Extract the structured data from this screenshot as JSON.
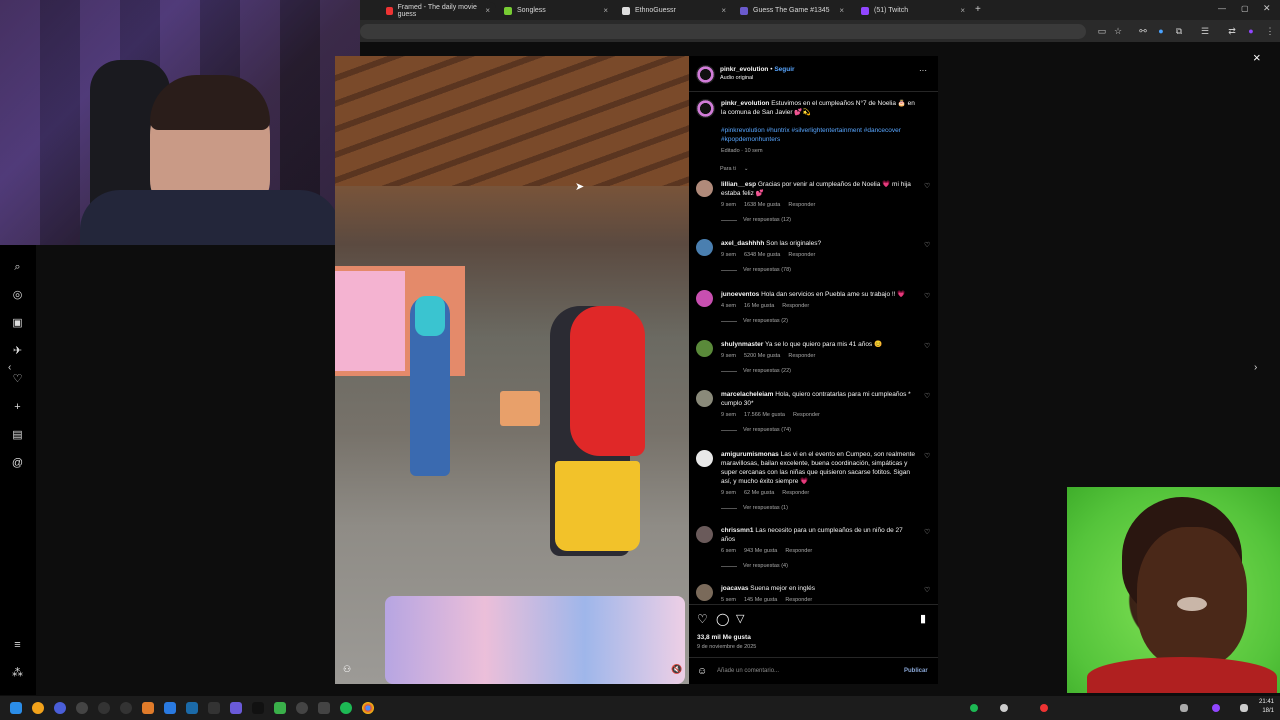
{
  "browser": {
    "tabs": [
      {
        "label": "Framed - The daily movie guess",
        "color": "#e33"
      },
      {
        "label": "Songless",
        "color": "#7c3"
      },
      {
        "label": "EthnoGuessr",
        "color": "#ddd"
      },
      {
        "label": "Guess The Game #1345",
        "color": "#6a5acd"
      },
      {
        "label": "(51) Twitch",
        "color": "#9146ff"
      }
    ],
    "new_tab": "+",
    "close_tab": "×"
  },
  "post": {
    "author": "pinkr_evolution",
    "follow_label": "Seguir",
    "audio_label": "Audio original",
    "caption_author": "pinkr_evolution",
    "caption": "Estuvimos en el cumpleaños N°7 de Noelia 🎂 en la comuna de San Javier 💕💫",
    "hashtags": "#pinkrevolution #huntrix #silverlightentertainment #dancecover #kpopdemonhunters",
    "edited": "Editado · 10 sem",
    "filter_label": "Para ti",
    "likes": "33,8 mil Me gusta",
    "date": "9 de noviembre de 2025",
    "add_comment_placeholder": "Añade un comentario...",
    "publish_label": "Publicar",
    "close": "×",
    "more": "···"
  },
  "comments": [
    {
      "user": "lillian__esp",
      "text": "Gracias por venir al cumpleaños de Noelia 💗 mi hija estaba feliz 💕",
      "time": "9 sem",
      "likes": "1638 Me gusta",
      "reply": "Responder",
      "replies": "Ver respuestas (12)",
      "avatar": "#b08a7a"
    },
    {
      "user": "axel_dashhhh",
      "text": "Son las originales?",
      "time": "9 sem",
      "likes": "6348 Me gusta",
      "reply": "Responder",
      "replies": "Ver respuestas (78)",
      "avatar": "#4a7fb0"
    },
    {
      "user": "junoeventos",
      "text": "Hola dan servicios en Puebla ame su trabajo !! 💗",
      "time": "4 sem",
      "likes": "16 Me gusta",
      "reply": "Responder",
      "replies": "Ver respuestas (2)",
      "avatar": "#c84fb0"
    },
    {
      "user": "shulynmaster",
      "text": "Ya se lo que quiero para mis 41 años 😊",
      "time": "9 sem",
      "likes": "5200 Me gusta",
      "reply": "Responder",
      "replies": "Ver respuestas (22)",
      "avatar": "#5a8a3a"
    },
    {
      "user": "marcelacheleiam",
      "text": "Hola, quiero contratarlas para mi cumpleaños * cumplo 30*",
      "time": "9 sem",
      "likes": "17.566 Me gusta",
      "reply": "Responder",
      "replies": "Ver respuestas (74)",
      "avatar": "#8a8a7a"
    },
    {
      "user": "amigurumismonas",
      "text": "Las vi en el evento en Cumpeo, son realmente maravillosas, bailan excelente, buena coordinación, simpáticas y super cercanas con las niñas que quisieron sacarse fotitos. Sigan así, y mucho éxito siempre 💗",
      "time": "9 sem",
      "likes": "62 Me gusta",
      "reply": "Responder",
      "replies": "Ver respuestas (1)",
      "avatar": "#e8e8e8"
    },
    {
      "user": "chrissmn1",
      "text": "Las necesito para un cumpleaños de un niño de 27 años",
      "time": "6 sem",
      "likes": "943 Me gusta",
      "reply": "Responder",
      "replies": "Ver respuestas (4)",
      "avatar": "#6a5a5a"
    },
    {
      "user": "joacavas",
      "text": "Suena mejor en inglés",
      "time": "5 sem",
      "likes": "145 Me gusta",
      "reply": "Responder",
      "replies": "",
      "avatar": "#7a6a5a"
    }
  ],
  "taskbar": {
    "time": "21:41",
    "date": "18/1"
  },
  "colors": {
    "link_blue": "#58a6ff",
    "panel_bg": "#000000",
    "muted": "#a8a8a8"
  }
}
